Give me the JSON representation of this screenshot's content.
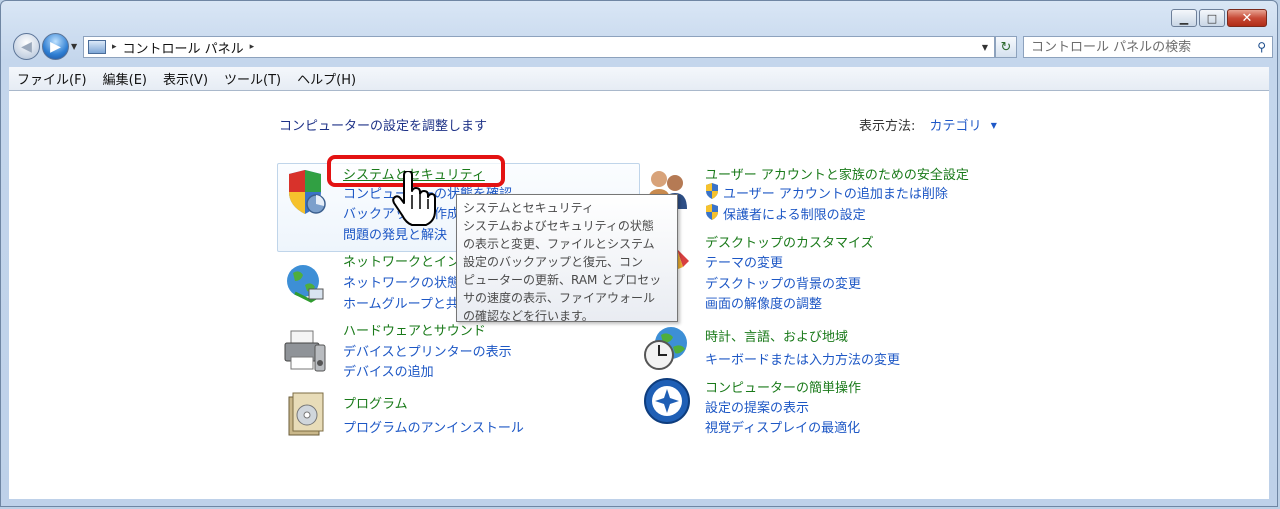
{
  "address": {
    "path": "コントロール パネル",
    "separator": "▸"
  },
  "search": {
    "placeholder": "コントロール パネルの検索"
  },
  "window_buttons": {
    "minimize": "▁",
    "maximize": "□",
    "close": "✕"
  },
  "menu": {
    "items": [
      "ファイル(F)",
      "編集(E)",
      "表示(V)",
      "ツール(T)",
      "ヘルプ(H)"
    ]
  },
  "heading": "コンピューターの設定を調整します",
  "view_mode": {
    "label": "表示方法:",
    "value": "カテゴリ"
  },
  "categories": {
    "system_security": {
      "title": "システムとセキュリティ",
      "links": [
        "コンピューターの状態を確認",
        "バックアップの作成",
        "問題の発見と解決"
      ]
    },
    "network": {
      "title": "ネットワークとインターネット",
      "links": [
        "ネットワークの状態とタスクの表示",
        "ホームグループと共有に関するオプションの選択"
      ]
    },
    "hardware": {
      "title": "ハードウェアとサウンド",
      "links": [
        "デバイスとプリンターの表示",
        "デバイスの追加"
      ]
    },
    "programs": {
      "title": "プログラム",
      "links": [
        "プログラムのアンインストール"
      ]
    },
    "user_accounts": {
      "title": "ユーザー アカウントと家族のための安全設定",
      "links": [
        "ユーザー アカウントの追加または削除",
        "保護者による制限の設定"
      ]
    },
    "appearance": {
      "title": "デスクトップのカスタマイズ",
      "links": [
        "テーマの変更",
        "デスクトップの背景の変更",
        "画面の解像度の調整"
      ]
    },
    "clock": {
      "title": "時計、言語、および地域",
      "links": [
        "キーボードまたは入力方法の変更"
      ]
    },
    "ease": {
      "title": "コンピューターの簡単操作",
      "links": [
        "設定の提案の表示",
        "視覚ディスプレイの最適化"
      ]
    }
  },
  "tooltip": {
    "lines": [
      "システムとセキュリティ",
      "システムおよびセキュリティの状態",
      "の表示と変更、ファイルとシステム",
      "設定のバックアップと復元、コン",
      "ピューターの更新、RAM とプロセッ",
      "サの速度の表示、ファイアウォール",
      "の確認などを行います。"
    ]
  },
  "colors": {
    "category_title": "#1a7a1a",
    "link": "#1d57c5",
    "highlight_box": "#e31212",
    "heading": "#1e3287"
  }
}
